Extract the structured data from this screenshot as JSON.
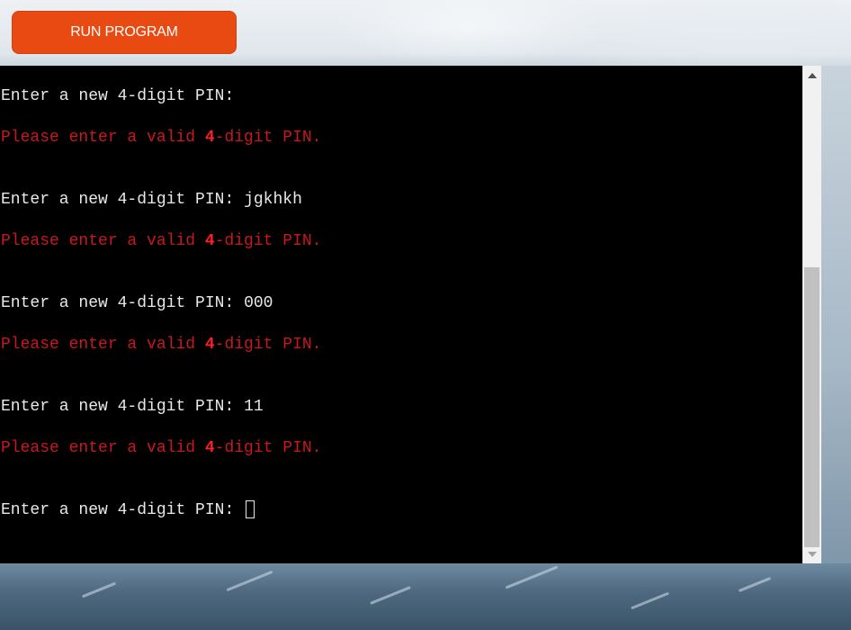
{
  "toolbar": {
    "run_label": "RUN PROGRAM"
  },
  "terminal": {
    "lines": [
      {
        "kind": "prompt",
        "text": "Enter a new 4-digit PIN:",
        "input": ""
      },
      {
        "kind": "error",
        "before": "Please enter a valid ",
        "digit": "4",
        "after": "-digit PIN."
      },
      {
        "kind": "prompt",
        "text": "Enter a new 4-digit PIN:",
        "input": "jgkhkh"
      },
      {
        "kind": "error",
        "before": "Please enter a valid ",
        "digit": "4",
        "after": "-digit PIN."
      },
      {
        "kind": "prompt",
        "text": "Enter a new 4-digit PIN:",
        "input": "000"
      },
      {
        "kind": "error",
        "before": "Please enter a valid ",
        "digit": "4",
        "after": "-digit PIN."
      },
      {
        "kind": "prompt",
        "text": "Enter a new 4-digit PIN:",
        "input": "11"
      },
      {
        "kind": "error",
        "before": "Please enter a valid ",
        "digit": "4",
        "after": "-digit PIN."
      },
      {
        "kind": "prompt",
        "text": "Enter a new 4-digit PIN:",
        "input": ""
      }
    ],
    "scroll_position": 0.92
  },
  "colors": {
    "button": "#e84a12",
    "terminal_bg": "#000000",
    "terminal_text": "#e8e8e8",
    "error_text": "#c8181d",
    "error_digit": "#ff1f24"
  },
  "icons": {
    "scroll_up": "triangle-up-icon",
    "scroll_down": "triangle-down-icon"
  }
}
